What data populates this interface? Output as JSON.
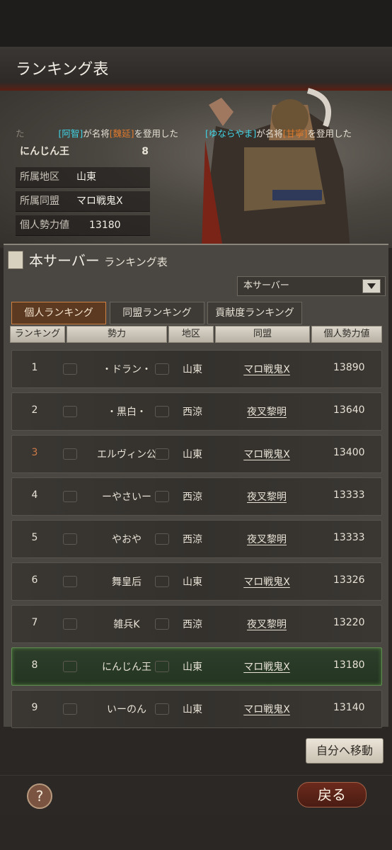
{
  "page": {
    "title": "ランキング表"
  },
  "ticker": {
    "left_prefix": "た",
    "left_user": "[阿智]",
    "left_text1": "が名将",
    "left_general": "[魏延]",
    "left_text2": "を登用した",
    "right_user": "[ゆならやま]",
    "right_text1": "が名将",
    "right_general": "[甘寧]",
    "right_text2": "を登用した"
  },
  "player": {
    "name": "にんじん王",
    "rank": "8",
    "region_label": "所属地区",
    "region_value": "山東",
    "alliance_label": "所属同盟",
    "alliance_value": "マロ戦鬼X",
    "power_label": "個人勢力値",
    "power_value": "13180"
  },
  "panel": {
    "title": "本サーバー",
    "subtitle": "ランキング表",
    "server_select": "本サーバー"
  },
  "tabs": [
    {
      "label": "個人ランキング"
    },
    {
      "label": "同盟ランキング"
    },
    {
      "label": "貢献度ランキング"
    }
  ],
  "columns": [
    "ランキング",
    "勢力",
    "地区",
    "同盟",
    "個人勢力値"
  ],
  "rows": [
    {
      "rank": "1",
      "name": "・ドラン・",
      "region": "山東",
      "alliance": "マロ戦鬼X",
      "power": "13890"
    },
    {
      "rank": "2",
      "name": "・黒白・",
      "region": "西涼",
      "alliance": "夜叉黎明",
      "power": "13640"
    },
    {
      "rank": "3",
      "name": "エルヴィン公",
      "region": "山東",
      "alliance": "マロ戦鬼X",
      "power": "13400"
    },
    {
      "rank": "4",
      "name": "ーやさいー",
      "region": "西涼",
      "alliance": "夜叉黎明",
      "power": "13333"
    },
    {
      "rank": "5",
      "name": "やおや",
      "region": "西涼",
      "alliance": "夜叉黎明",
      "power": "13333"
    },
    {
      "rank": "6",
      "name": "舞皇后",
      "region": "山東",
      "alliance": "マロ戦鬼X",
      "power": "13326"
    },
    {
      "rank": "7",
      "name": "雑兵K",
      "region": "西涼",
      "alliance": "夜叉黎明",
      "power": "13220"
    },
    {
      "rank": "8",
      "name": "にんじん王",
      "region": "山東",
      "alliance": "マロ戦鬼X",
      "power": "13180"
    },
    {
      "rank": "9",
      "name": "いーのん",
      "region": "山東",
      "alliance": "マロ戦鬼X",
      "power": "13140"
    }
  ],
  "buttons": {
    "move_to_self": "自分へ移動",
    "back": "戻る",
    "help": "?"
  }
}
